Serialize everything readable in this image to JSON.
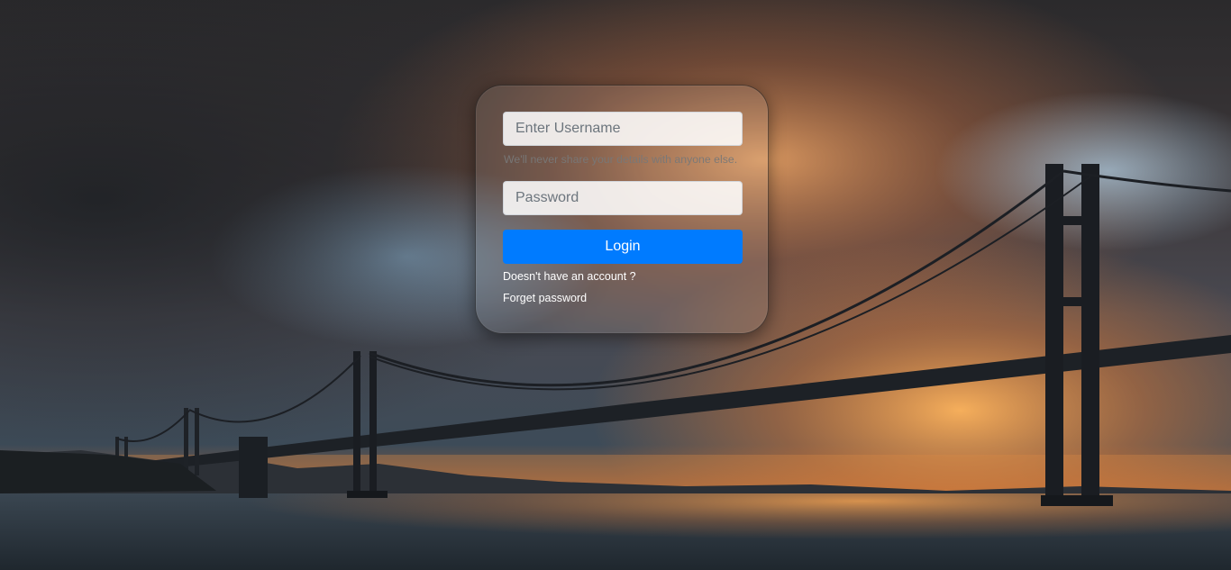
{
  "login_form": {
    "username_placeholder": "Enter Username",
    "help_text": "We'll never share your details with anyone else.",
    "password_placeholder": "Password",
    "login_label": "Login",
    "signup_link": "Doesn't have an account ?",
    "forgot_link": "Forget password"
  },
  "colors": {
    "primary_button": "#007bff",
    "link_text": "#ffffff"
  },
  "background": {
    "scene": "bridge-at-sunset-photo"
  }
}
